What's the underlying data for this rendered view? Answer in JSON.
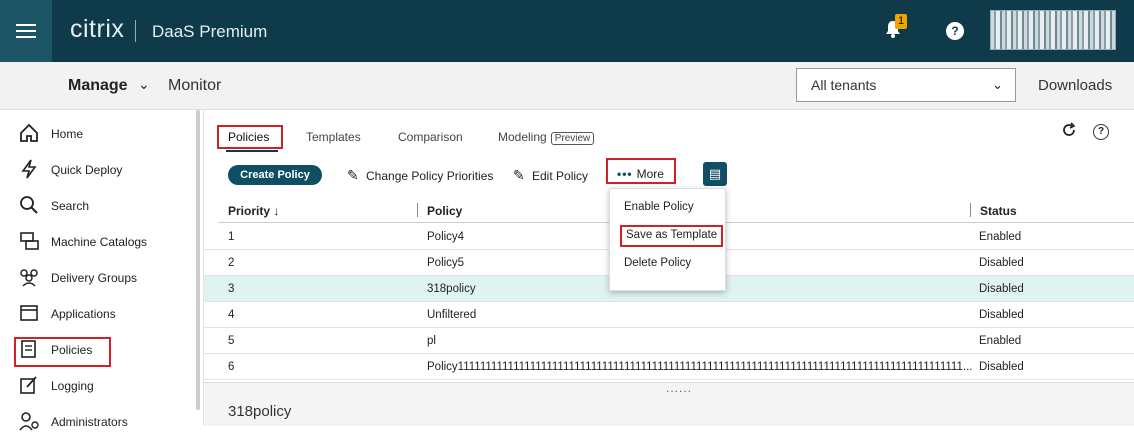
{
  "header": {
    "logo": "citrix",
    "product": "DaaS Premium",
    "notification_count": "1",
    "help": "?"
  },
  "subbar": {
    "manage": "Manage",
    "monitor": "Monitor",
    "tenant_select": "All tenants",
    "downloads": "Downloads"
  },
  "sidebar": {
    "items": [
      {
        "label": "Home",
        "icon": "home-icon"
      },
      {
        "label": "Quick Deploy",
        "icon": "bolt-icon"
      },
      {
        "label": "Search",
        "icon": "search-icon"
      },
      {
        "label": "Machine Catalogs",
        "icon": "machine-icon"
      },
      {
        "label": "Delivery Groups",
        "icon": "group-icon"
      },
      {
        "label": "Applications",
        "icon": "window-icon"
      },
      {
        "label": "Policies",
        "icon": "policy-icon"
      },
      {
        "label": "Logging",
        "icon": "log-icon"
      },
      {
        "label": "Administrators",
        "icon": "admin-icon"
      }
    ]
  },
  "tabs": [
    "Policies",
    "Templates",
    "Comparison",
    "Modeling"
  ],
  "preview_badge": "Preview",
  "toolbar": {
    "create": "Create Policy",
    "change_priorities": "Change Policy Priorities",
    "edit": "Edit Policy",
    "more": "More"
  },
  "table": {
    "headers": [
      "Priority ↓",
      "Policy",
      "Status"
    ],
    "rows": [
      [
        "1",
        "Policy4",
        "Enabled"
      ],
      [
        "2",
        "Policy5",
        "Disabled"
      ],
      [
        "3",
        "318policy",
        "Disabled"
      ],
      [
        "4",
        "Unfiltered",
        "Disabled"
      ],
      [
        "5",
        "pl",
        "Enabled"
      ],
      [
        "6",
        "Policy1111111111111111111111111111111111111111111111111111111111111111111111111111111111111111111...",
        "Disabled"
      ]
    ]
  },
  "more_menu": [
    "Enable Policy",
    "Save as Template",
    "Delete Policy"
  ],
  "detail": {
    "dots": "......",
    "title": "318policy"
  },
  "colors": {
    "header_bg": "#0e3a4a",
    "accent": "#0e4f63",
    "highlight_red": "#d0202a",
    "selected_row": "#e0f3f3"
  }
}
